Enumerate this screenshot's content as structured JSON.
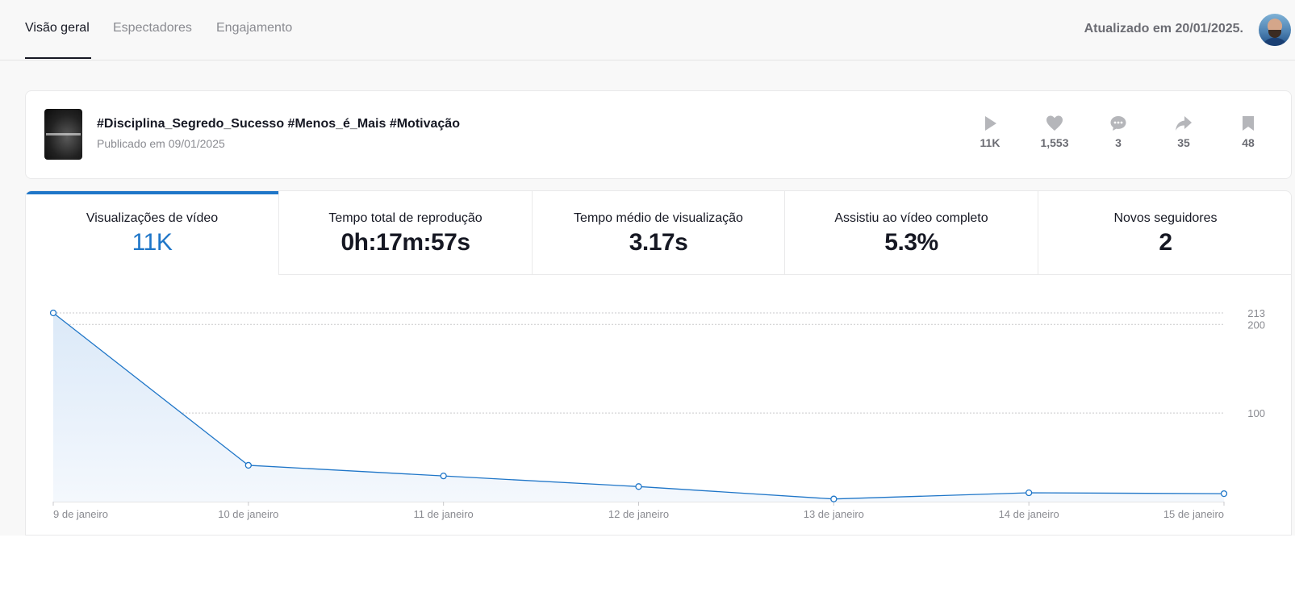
{
  "nav": {
    "tabs": [
      {
        "label": "Visão geral",
        "active": true
      },
      {
        "label": "Espectadores",
        "active": false
      },
      {
        "label": "Engajamento",
        "active": false
      }
    ],
    "updated_text": "Atualizado em 20/01/2025."
  },
  "video": {
    "title": "#Disciplina_Segredo_Sucesso #Menos_é_Mais #Motivação",
    "published": "Publicado em 09/01/2025",
    "stats": [
      {
        "icon": "play-icon",
        "value": "11K"
      },
      {
        "icon": "heart-icon",
        "value": "1,553"
      },
      {
        "icon": "comment-icon",
        "value": "3"
      },
      {
        "icon": "share-icon",
        "value": "35"
      },
      {
        "icon": "bookmark-icon",
        "value": "48"
      }
    ]
  },
  "metrics": [
    {
      "label": "Visualizações de vídeo",
      "value": "11K",
      "active": true
    },
    {
      "label": "Tempo total de reprodução",
      "value": "0h:17m:57s",
      "active": false
    },
    {
      "label": "Tempo médio de visualização",
      "value": "3.17s",
      "active": false
    },
    {
      "label": "Assistiu ao vídeo completo",
      "value": "5.3%",
      "active": false
    },
    {
      "label": "Novos seguidores",
      "value": "2",
      "active": false
    }
  ],
  "colors": {
    "accent": "#1f76c8",
    "text": "#161823",
    "muted": "#8a8b91"
  },
  "chart_data": {
    "type": "area",
    "x": [
      "9 de janeiro",
      "10 de janeiro",
      "11 de janeiro",
      "12 de janeiro",
      "13 de janeiro",
      "14 de janeiro",
      "15 de janeiro"
    ],
    "values": [
      213,
      41,
      29,
      17,
      3,
      10,
      9
    ],
    "y_ticks": [
      100,
      200,
      213
    ],
    "ylim": [
      0,
      213
    ],
    "grid": true,
    "axis_side": "right"
  }
}
